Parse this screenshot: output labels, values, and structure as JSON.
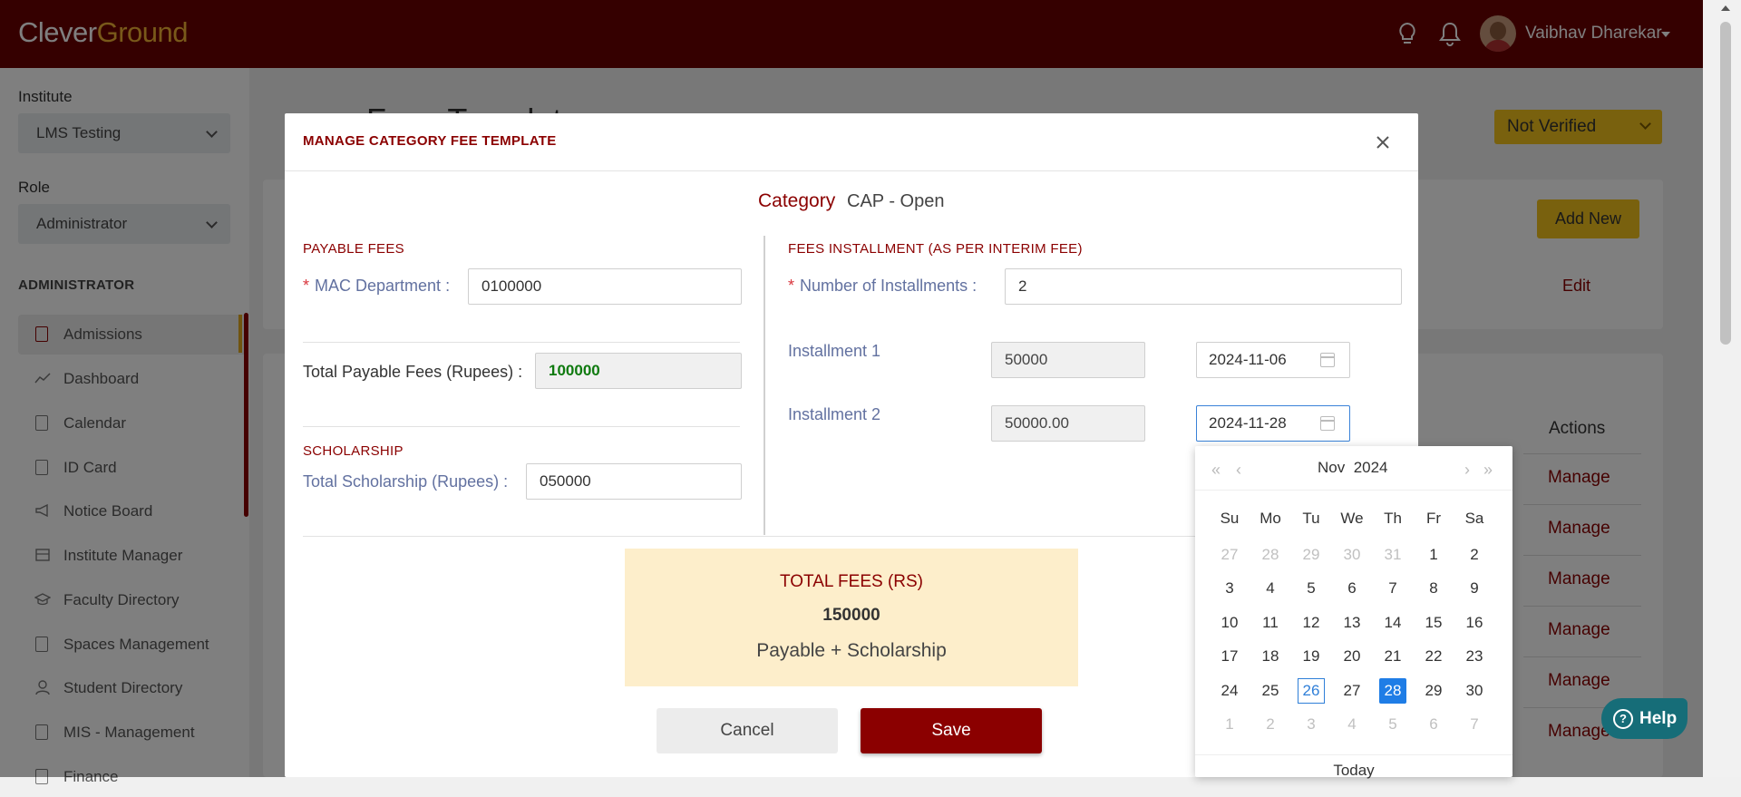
{
  "header": {
    "logo_part1": "Clever",
    "logo_part2": "Ground",
    "user_name": "Vaibhav Dharekar"
  },
  "sidebar": {
    "institute_label": "Institute",
    "institute_value": "LMS Testing",
    "role_label": "Role",
    "role_value": "Administrator",
    "section": "ADMINISTRATOR",
    "items": [
      {
        "label": "Admissions"
      },
      {
        "label": "Dashboard"
      },
      {
        "label": "Calendar"
      },
      {
        "label": "ID Card"
      },
      {
        "label": "Notice Board"
      },
      {
        "label": "Institute Manager"
      },
      {
        "label": "Faculty Directory"
      },
      {
        "label": "Spaces Management"
      },
      {
        "label": "Student Directory"
      },
      {
        "label": "MIS - Management"
      },
      {
        "label": "Finance"
      }
    ]
  },
  "background": {
    "page_title": "Fees Template",
    "status": "Not Verified",
    "add_new": "Add New",
    "edit": "Edit",
    "actions_header": "Actions",
    "manage": [
      "Manage",
      "Manage",
      "Manage",
      "Manage",
      "Manage",
      "Manage"
    ]
  },
  "modal": {
    "title": "MANAGE CATEGORY FEE TEMPLATE",
    "category_label": "Category",
    "category_value": "CAP - Open",
    "payable_heading": "PAYABLE FEES",
    "mac_label": "MAC Department",
    "mac_value": "0100000",
    "total_payable_label": "Total Payable Fees (Rupees)",
    "total_payable_value": "100000",
    "scholarship_heading": "SCHOLARSHIP",
    "total_scholarship_label": "Total Scholarship (Rupees)",
    "total_scholarship_value": "050000",
    "installment_heading": "FEES INSTALLMENT (AS PER INTERIM FEE)",
    "num_installments_label": "Number of Installments",
    "num_installments_value": "2",
    "installments": [
      {
        "label": "Installment 1",
        "amount": "50000",
        "date": "2024-11-06"
      },
      {
        "label": "Installment 2",
        "amount": "50000.00",
        "date": "2024-11-28"
      }
    ],
    "totals_title": "TOTAL FEES (RS)",
    "totals_value": "150000",
    "totals_sub": "Payable + Scholarship",
    "cancel": "Cancel",
    "save": "Save"
  },
  "datepicker": {
    "month": "Nov",
    "year": "2024",
    "weekdays": [
      "Su",
      "Mo",
      "Tu",
      "We",
      "Th",
      "Fr",
      "Sa"
    ],
    "weeks": [
      [
        "27",
        "28",
        "29",
        "30",
        "31",
        "1",
        "2"
      ],
      [
        "3",
        "4",
        "5",
        "6",
        "7",
        "8",
        "9"
      ],
      [
        "10",
        "11",
        "12",
        "13",
        "14",
        "15",
        "16"
      ],
      [
        "17",
        "18",
        "19",
        "20",
        "21",
        "22",
        "23"
      ],
      [
        "24",
        "25",
        "26",
        "27",
        "28",
        "29",
        "30"
      ],
      [
        "1",
        "2",
        "3",
        "4",
        "5",
        "6",
        "7"
      ]
    ],
    "today_day": "26",
    "selected_day": "28",
    "today_label": "Today"
  },
  "help": {
    "label": "Help"
  },
  "colors": {
    "brand": "#6b0000",
    "accent": "#f2c31c",
    "primary_red": "#8b0000",
    "selected_blue": "#1f7de6"
  }
}
